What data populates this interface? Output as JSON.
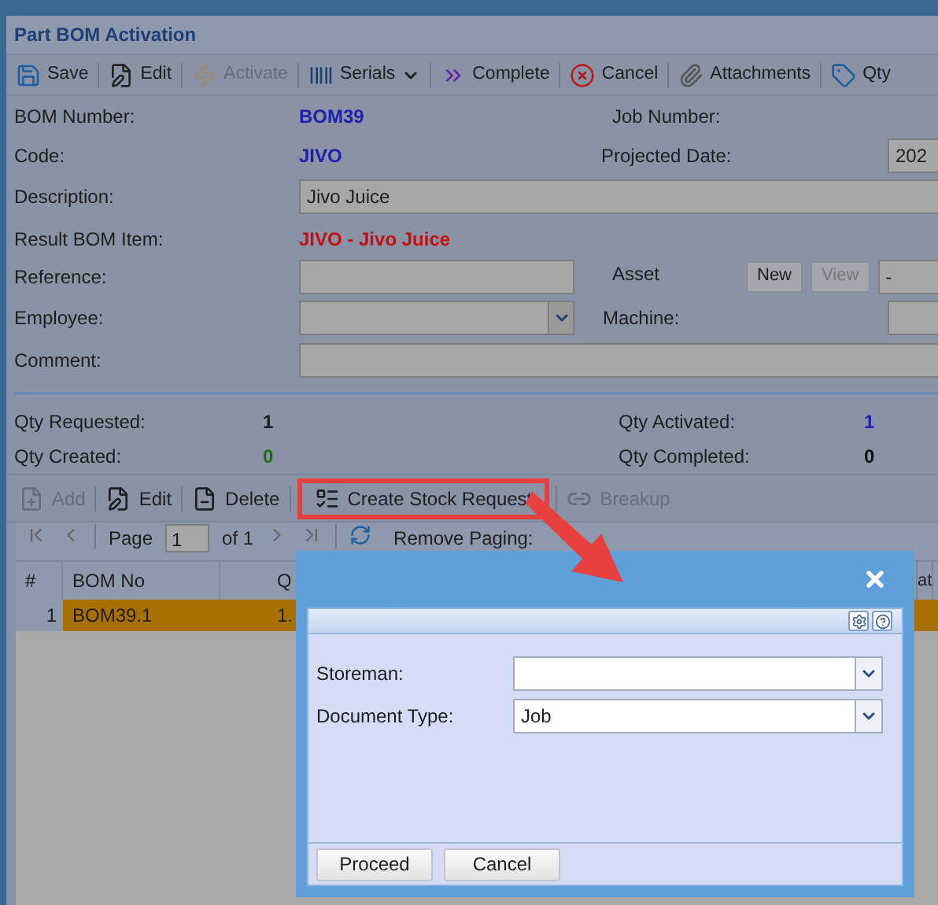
{
  "window": {
    "title": "Part BOM Activation"
  },
  "toolbar": [
    {
      "label": "Save",
      "kind": "button",
      "disabled": false
    },
    {
      "label": "Edit",
      "kind": "button",
      "disabled": false
    },
    {
      "label": "Activate",
      "kind": "button",
      "disabled": true
    },
    {
      "label": "Serials",
      "kind": "menu",
      "disabled": false
    },
    {
      "label": "Complete",
      "kind": "button",
      "disabled": false
    },
    {
      "label": "Cancel",
      "kind": "button",
      "disabled": false
    },
    {
      "label": "Attachments",
      "kind": "button",
      "disabled": false
    },
    {
      "label": "Qty",
      "kind": "button",
      "disabled": false
    }
  ],
  "form": {
    "bom_number": {
      "label": "BOM Number:",
      "value": "BOM39"
    },
    "job_number": {
      "label": "Job Number:"
    },
    "code": {
      "label": "Code:",
      "value": "JIVO"
    },
    "projected_date": {
      "label": "Projected Date:",
      "value": "202"
    },
    "description": {
      "label": "Description:",
      "value": "Jivo Juice"
    },
    "result_bom_item": {
      "label": "Result BOM Item:",
      "value": "JIVO - Jivo Juice"
    },
    "reference": {
      "label": "Reference:"
    },
    "asset": {
      "label": "Asset",
      "buttons": [
        {
          "label": "New",
          "disabled": false
        },
        {
          "label": "View",
          "disabled": true
        }
      ],
      "value": "-"
    },
    "employee": {
      "label": "Employee:"
    },
    "machine": {
      "label": "Machine:"
    },
    "comment": {
      "label": "Comment:"
    }
  },
  "quantities": [
    {
      "label": "Qty Requested:",
      "value": "1",
      "color": "#1e1e1e"
    },
    {
      "label": "Qty Activated:",
      "value": "1",
      "color": "#1f1fb0"
    },
    {
      "label": "Qty Created:",
      "value": "0",
      "color": "#1c6e12"
    },
    {
      "label": "Qty Completed:",
      "value": "0",
      "color": "#111111"
    }
  ],
  "grid_toolbar": [
    {
      "label": "Add",
      "disabled": true,
      "highlighted": false
    },
    {
      "label": "Edit",
      "disabled": false,
      "highlighted": false
    },
    {
      "label": "Delete",
      "disabled": false,
      "highlighted": false
    },
    {
      "label": "Create Stock Request",
      "disabled": false,
      "highlighted": true
    },
    {
      "label": "Breakup",
      "disabled": true,
      "highlighted": false
    }
  ],
  "pager": {
    "page_label": "Page",
    "page": "1",
    "of": "of 1",
    "remove_paging": "Remove Paging:"
  },
  "table": {
    "columns": [
      "#",
      "BOM No",
      "Q",
      "at"
    ],
    "rows": [
      {
        "cells": [
          "1",
          "BOM39.1",
          "1."
        ],
        "selected": true
      }
    ]
  },
  "dialog": {
    "fields": [
      {
        "label": "Storeman:"
      },
      {
        "label": "Document Type:",
        "value": "Job"
      }
    ],
    "buttons": [
      "Proceed",
      "Cancel"
    ]
  }
}
